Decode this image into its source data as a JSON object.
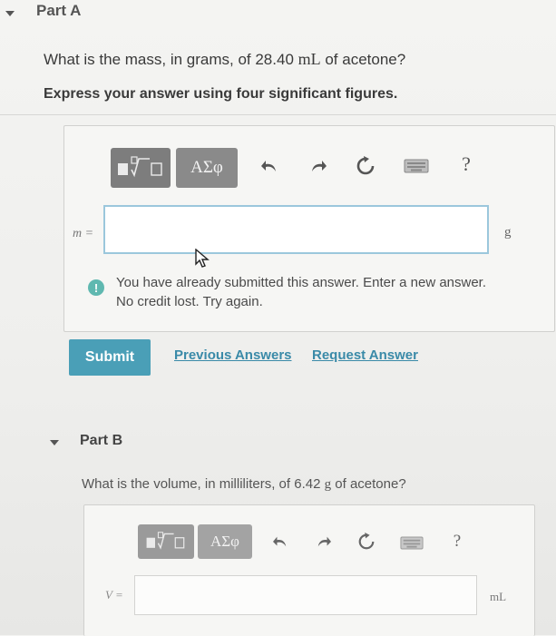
{
  "part_a": {
    "title": "Part A",
    "question_pre": "What is the mass, in grams, of 28.40 ",
    "question_unit": "mL",
    "question_post": " of acetone?",
    "instruction": "Express your answer using four significant figures.",
    "toolbar": {
      "greek_label": "ΑΣφ",
      "help_label": "?"
    },
    "variable_label": "m =",
    "answer_value": "",
    "unit": "g",
    "warning_line1": "You have already submitted this answer. Enter a new answer.",
    "warning_line2": "No credit lost. Try again.",
    "submit_label": "Submit",
    "previous_answers_label": "Previous Answers",
    "request_answer_label": "Request Answer"
  },
  "part_b": {
    "title": "Part B",
    "question_pre": "What is the volume, in milliliters, of 6.42 ",
    "question_unit": "g",
    "question_post": " of acetone?",
    "toolbar": {
      "greek_label": "ΑΣφ",
      "help_label": "?"
    },
    "variable_label": "V =",
    "answer_value": "",
    "unit": "mL"
  },
  "colors": {
    "accent": "#4a9fb7",
    "link": "#3a8aa8",
    "warning": "#5fb8b0"
  }
}
